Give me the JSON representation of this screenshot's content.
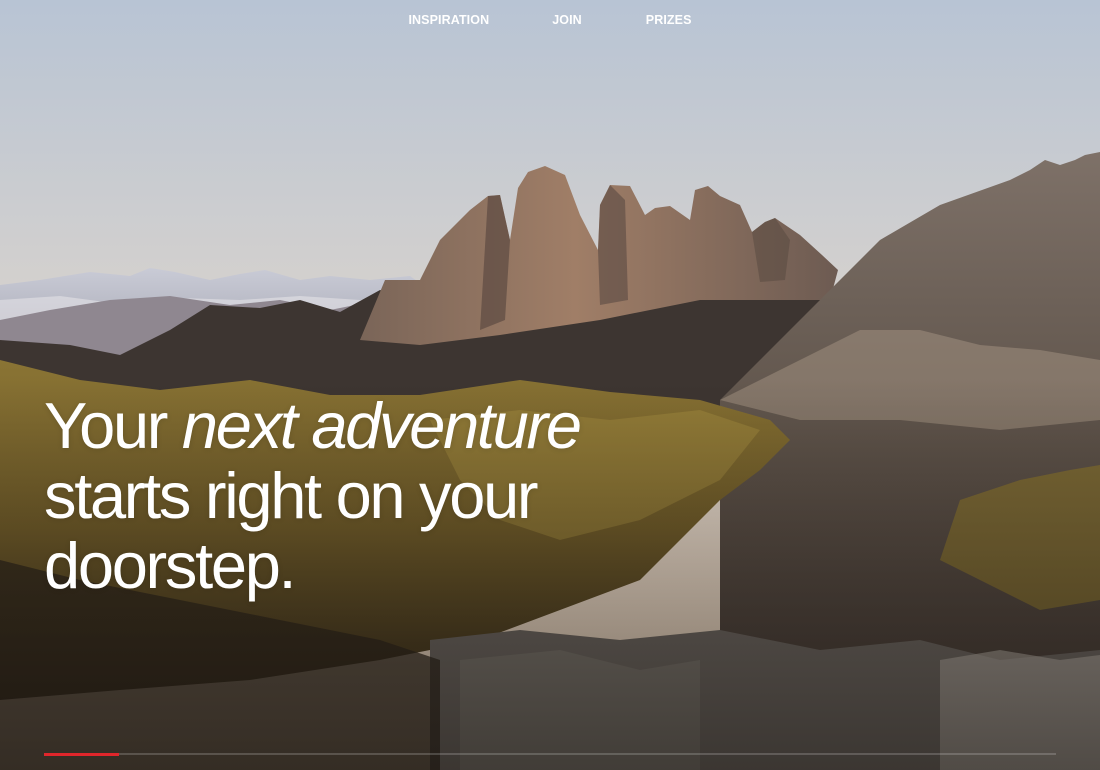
{
  "nav": {
    "items": [
      {
        "label": "INSPIRATION"
      },
      {
        "label": "JOIN"
      },
      {
        "label": "PRIZES"
      }
    ]
  },
  "hero": {
    "headline_part1": "Your ",
    "headline_emphasis": "next adventure",
    "headline_part2": " starts right on your doorstep.",
    "image_icon": "mountain-landscape"
  },
  "slider": {
    "progress_fraction": 0.074,
    "accent_color": "#e0262b"
  }
}
